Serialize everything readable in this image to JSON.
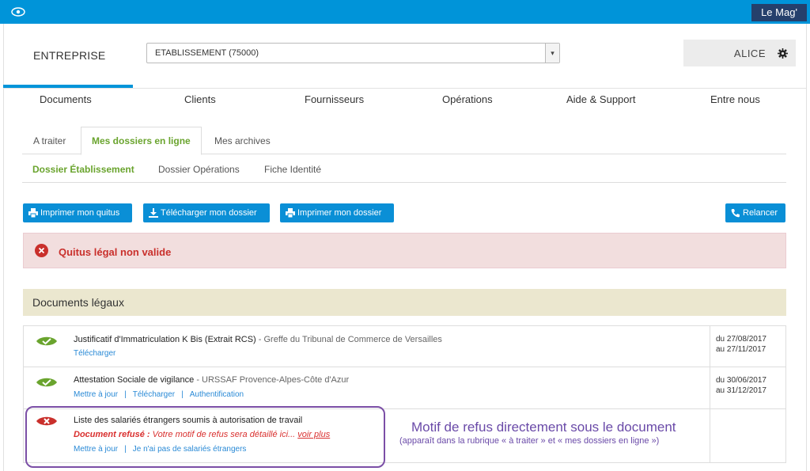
{
  "topbar": {
    "brand_label": "Le Mag'",
    "eye_icon": "eye-icon"
  },
  "header": {
    "company": "ENTREPRISE",
    "establishment_select": {
      "value": "ETABLISSEMENT (75000)",
      "arrow": "▾"
    },
    "user": {
      "name": "ALICE",
      "gear_icon": "gear-icon"
    }
  },
  "nav": {
    "items": [
      {
        "label": "Documents"
      },
      {
        "label": "Clients"
      },
      {
        "label": "Fournisseurs"
      },
      {
        "label": "Opérations"
      },
      {
        "label": "Aide & Support"
      },
      {
        "label": "Entre nous"
      }
    ]
  },
  "tabs": {
    "items": [
      {
        "label": "A traiter"
      },
      {
        "label": "Mes dossiers en ligne"
      },
      {
        "label": "Mes archives"
      }
    ],
    "active": "Mes dossiers en ligne"
  },
  "subtabs": {
    "items": [
      {
        "label": "Dossier Établissement"
      },
      {
        "label": "Dossier Opérations"
      },
      {
        "label": "Fiche Identité"
      }
    ]
  },
  "actions": {
    "print_quitus": "Imprimer mon quitus",
    "download_file": "Télécharger mon dossier",
    "print_file": "Imprimer mon dossier",
    "remind": "Relancer"
  },
  "alert": {
    "text": "Quitus légal non valide"
  },
  "section": {
    "title": "Documents légaux"
  },
  "documents": [
    {
      "title": "Justificatif d'Immatriculation K Bis (Extrait RCS)",
      "source": " - Greffe du Tribunal de Commerce de Versailles",
      "links": [
        "Télécharger"
      ],
      "date_from": "du 27/08/2017",
      "date_to": "au 27/11/2017",
      "status": "valid"
    },
    {
      "title": "Attestation Sociale de vigilance",
      "source": " - URSSAF Provence-Alpes-Côte d'Azur",
      "links": [
        "Mettre à jour",
        "Télécharger",
        "Authentification"
      ],
      "date_from": "du 30/06/2017",
      "date_to": "au 31/12/2017",
      "status": "valid"
    },
    {
      "title": "Liste des salariés étrangers soumis à autorisation de travail",
      "refusal_label": "Document refusé :",
      "refusal_text": " Votre motif de refus sera détaillé ici...",
      "refusal_more": "voir plus",
      "links": [
        "Mettre à jour",
        "Je n'ai pas de salariés étrangers"
      ],
      "status": "refused"
    }
  ],
  "annotation": {
    "main": "Motif de refus directement sous le document",
    "sub": "(apparaît dans la rubrique « à traiter » et « mes dossiers en ligne »)"
  },
  "colors": {
    "accent": "#0094d9",
    "brand_dark": "#25406c",
    "success": "#6aa42e",
    "danger": "#c9302c",
    "annotation": "#6a4aa8"
  }
}
